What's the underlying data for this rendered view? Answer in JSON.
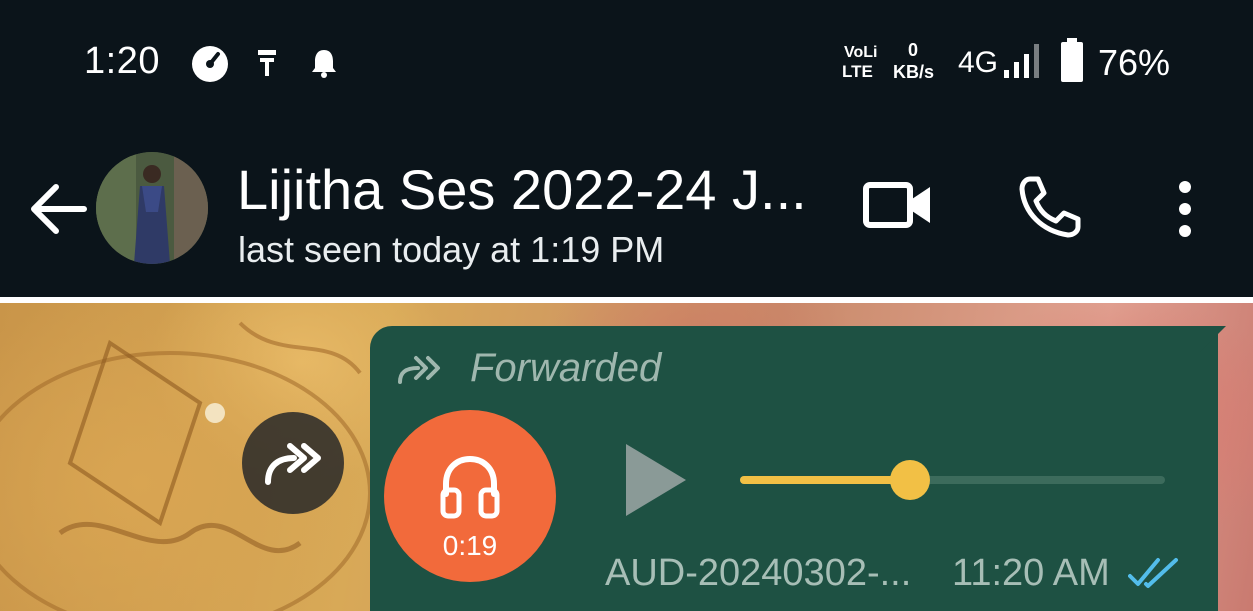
{
  "status_bar": {
    "time": "1:20",
    "volte_label_top": "VoLi",
    "volte_label_bottom": "LTE",
    "data_speed_value": "0",
    "data_speed_unit": "KB/s",
    "network_type": "4G",
    "battery_percent": "76%",
    "icons": [
      "gauge-icon",
      "usb-icon",
      "notification-bell-icon",
      "signal-icon",
      "battery-icon"
    ]
  },
  "header": {
    "contact_name": "Lijitha Ses 2022-24 J...",
    "last_seen": "last seen today at 1:19 PM",
    "icons": [
      "back-arrow-icon",
      "video-call-icon",
      "voice-call-icon",
      "more-options-icon"
    ]
  },
  "message": {
    "forwarded_label": "Forwarded",
    "audio_duration": "0:19",
    "playback_progress": 0.4,
    "file_name": "AUD-20240302-...",
    "time": "11:20 AM",
    "status": "read",
    "icons": [
      "forwarded-icon",
      "headphones-icon",
      "play-icon",
      "double-check-icon"
    ]
  },
  "colors": {
    "header_bg": "#0b141a",
    "bubble_bg": "#1e5143",
    "audio_avatar": "#f26a3b",
    "seek_bar": "#f2c045",
    "read_ticks": "#53bdeb"
  }
}
